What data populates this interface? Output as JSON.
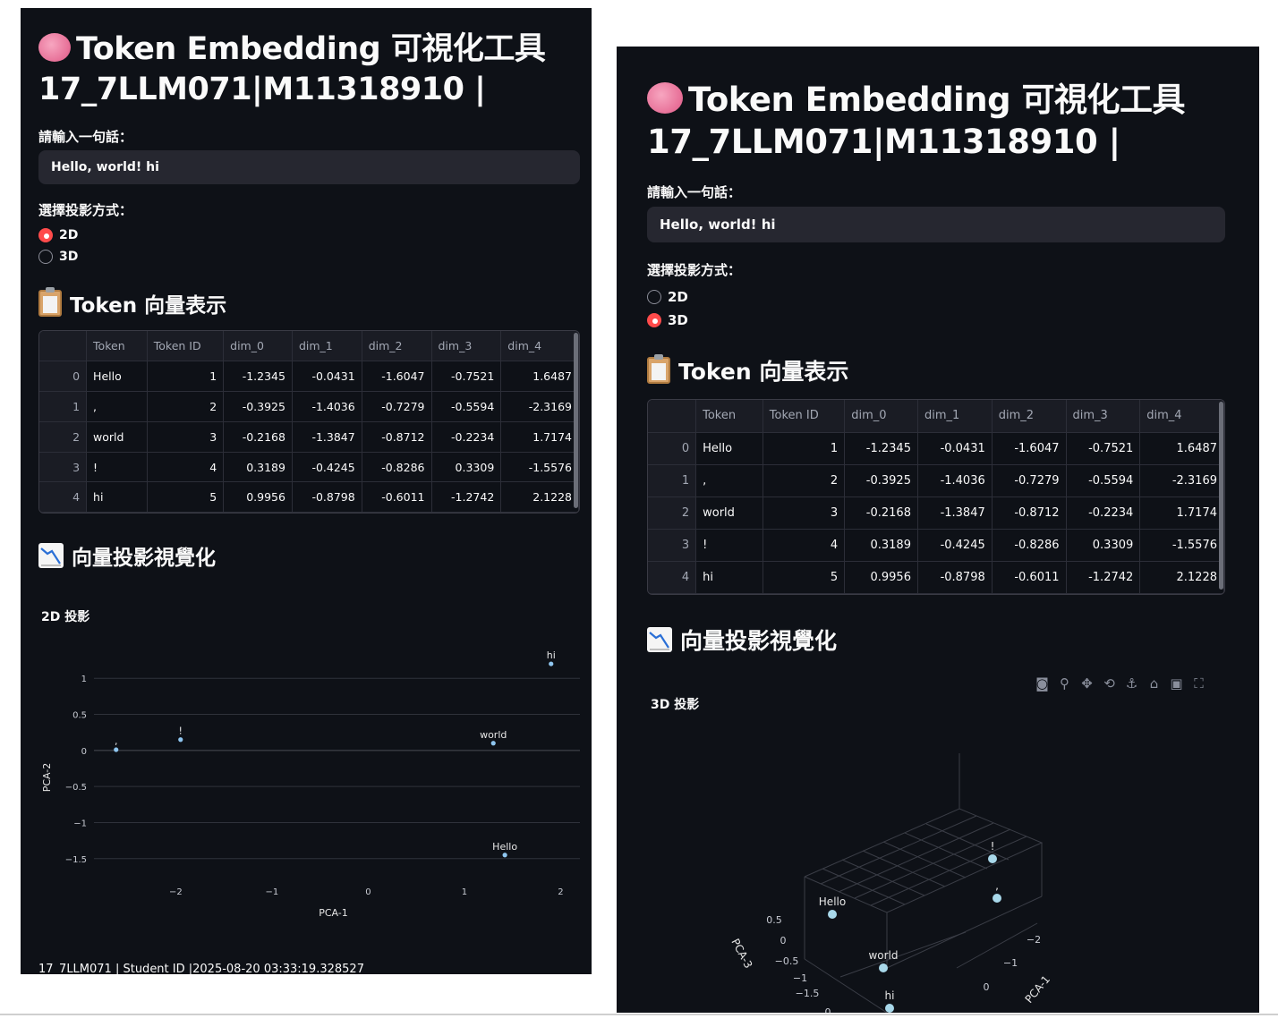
{
  "app": {
    "title_line1": "Token Embedding 可視化工具",
    "title_line2": "17_7LLM071|M11318910 |",
    "input_label": "請輸入一句話：",
    "input_value": "Hello, world! hi",
    "projection_label": "選擇投影方式：",
    "radio_options": [
      "2D",
      "3D"
    ],
    "table_section": "Token 向量表示",
    "viz_section": "向量投影視覺化"
  },
  "table": {
    "columns": [
      "",
      "Token",
      "Token ID",
      "dim_0",
      "dim_1",
      "dim_2",
      "dim_3",
      "dim_4"
    ],
    "rows": [
      [
        "0",
        "Hello",
        "1",
        "-1.2345",
        "-0.0431",
        "-1.6047",
        "-0.7521",
        "1.6487"
      ],
      [
        "1",
        ",",
        "2",
        "-0.3925",
        "-1.4036",
        "-0.7279",
        "-0.5594",
        "-2.3169"
      ],
      [
        "2",
        "world",
        "3",
        "-0.2168",
        "-1.3847",
        "-0.8712",
        "-0.2234",
        "1.7174"
      ],
      [
        "3",
        "!",
        "4",
        "0.3189",
        "-0.4245",
        "-0.8286",
        "0.3309",
        "-1.5576"
      ],
      [
        "4",
        "hi",
        "5",
        "0.9956",
        "-0.8798",
        "-0.6011",
        "-1.2742",
        "2.1228"
      ]
    ]
  },
  "left": {
    "selected_projection": "2D",
    "chart_title": "2D 投影",
    "footer": "17_7LLM071 | Student ID |2025-08-20 03:33:19.328527"
  },
  "right": {
    "selected_projection": "3D",
    "chart_title": "3D 投影",
    "toolbar_icons": [
      "camera-icon",
      "zoom-icon",
      "pan-icon",
      "orbit-icon",
      "turntable-icon",
      "home-icon",
      "video-camera-icon",
      "fullscreen-icon"
    ]
  },
  "chart_data": [
    {
      "type": "scatter",
      "title": "2D 投影",
      "xlabel": "PCA-1",
      "ylabel": "PCA-2",
      "xlim": [
        -2.85,
        2.2
      ],
      "ylim": [
        -1.8,
        1.3
      ],
      "x_ticks": [
        -2,
        -1,
        0,
        1,
        2
      ],
      "y_ticks": [
        1,
        0.5,
        0,
        -0.5,
        -1,
        -1.5
      ],
      "x_tick_labels": [
        "−2",
        "−1",
        "0",
        "1",
        "2"
      ],
      "y_tick_labels": [
        "1",
        "0.5",
        "0",
        "−0.5",
        "−1",
        "−1.5"
      ],
      "grid": "horizontal",
      "points": [
        {
          "label": "hi",
          "x": 1.9,
          "y": 1.2
        },
        {
          "label": "world",
          "x": 1.3,
          "y": 0.1
        },
        {
          "label": "!",
          "x": -1.95,
          "y": 0.15
        },
        {
          "label": ",",
          "x": -2.62,
          "y": 0.01
        },
        {
          "label": "Hello",
          "x": 1.42,
          "y": -1.45
        }
      ],
      "color": "#8fc6f0"
    },
    {
      "type": "scatter",
      "title": "3D 投影",
      "axis_labels": [
        "PCA-1",
        "PCA-3"
      ],
      "points": [
        {
          "label": "!"
        },
        {
          "label": ","
        },
        {
          "label": "Hello"
        },
        {
          "label": "world"
        },
        {
          "label": "hi"
        }
      ],
      "color": "#a8d8ea"
    }
  ]
}
